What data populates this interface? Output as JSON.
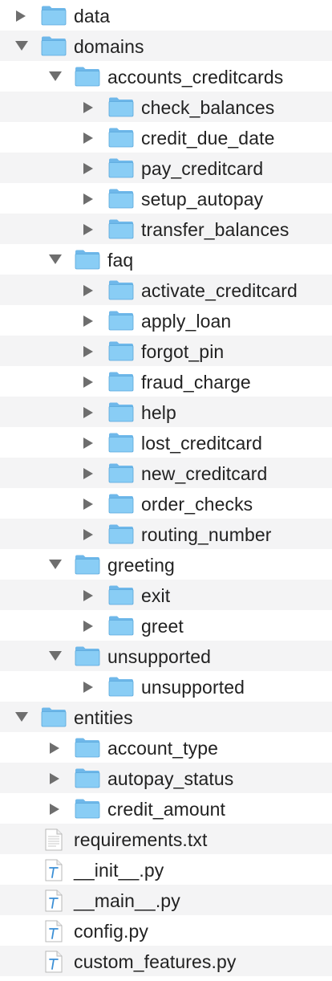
{
  "colors": {
    "folder_body": "#89cdf5",
    "folder_tab": "#6fb8ea",
    "folder_outline": "#5aa7db",
    "disclosure_arrow": "#6e6e6e",
    "row_stripe": "#f4f4f5",
    "text": "#222222"
  },
  "items": [
    {
      "label": "data",
      "type": "folder",
      "depth": 0,
      "expanded": false
    },
    {
      "label": "domains",
      "type": "folder",
      "depth": 0,
      "expanded": true
    },
    {
      "label": "accounts_creditcards",
      "type": "folder",
      "depth": 1,
      "expanded": true
    },
    {
      "label": "check_balances",
      "type": "folder",
      "depth": 2,
      "expanded": false
    },
    {
      "label": "credit_due_date",
      "type": "folder",
      "depth": 2,
      "expanded": false
    },
    {
      "label": "pay_creditcard",
      "type": "folder",
      "depth": 2,
      "expanded": false
    },
    {
      "label": "setup_autopay",
      "type": "folder",
      "depth": 2,
      "expanded": false
    },
    {
      "label": "transfer_balances",
      "type": "folder",
      "depth": 2,
      "expanded": false
    },
    {
      "label": "faq",
      "type": "folder",
      "depth": 1,
      "expanded": true
    },
    {
      "label": "activate_creditcard",
      "type": "folder",
      "depth": 2,
      "expanded": false
    },
    {
      "label": "apply_loan",
      "type": "folder",
      "depth": 2,
      "expanded": false
    },
    {
      "label": "forgot_pin",
      "type": "folder",
      "depth": 2,
      "expanded": false
    },
    {
      "label": "fraud_charge",
      "type": "folder",
      "depth": 2,
      "expanded": false
    },
    {
      "label": "help",
      "type": "folder",
      "depth": 2,
      "expanded": false
    },
    {
      "label": "lost_creditcard",
      "type": "folder",
      "depth": 2,
      "expanded": false
    },
    {
      "label": "new_creditcard",
      "type": "folder",
      "depth": 2,
      "expanded": false
    },
    {
      "label": "order_checks",
      "type": "folder",
      "depth": 2,
      "expanded": false
    },
    {
      "label": "routing_number",
      "type": "folder",
      "depth": 2,
      "expanded": false
    },
    {
      "label": "greeting",
      "type": "folder",
      "depth": 1,
      "expanded": true
    },
    {
      "label": "exit",
      "type": "folder",
      "depth": 2,
      "expanded": false
    },
    {
      "label": "greet",
      "type": "folder",
      "depth": 2,
      "expanded": false
    },
    {
      "label": "unsupported",
      "type": "folder",
      "depth": 1,
      "expanded": true
    },
    {
      "label": "unsupported",
      "type": "folder",
      "depth": 2,
      "expanded": false
    },
    {
      "label": "entities",
      "type": "folder",
      "depth": 0,
      "expanded": true
    },
    {
      "label": "account_type",
      "type": "folder",
      "depth": 1,
      "expanded": false
    },
    {
      "label": "autopay_status",
      "type": "folder",
      "depth": 1,
      "expanded": false
    },
    {
      "label": "credit_amount",
      "type": "folder",
      "depth": 1,
      "expanded": false
    },
    {
      "label": "requirements.txt",
      "type": "text-file",
      "depth": 0
    },
    {
      "label": "__init__.py",
      "type": "python-file",
      "depth": 0
    },
    {
      "label": "__main__.py",
      "type": "python-file",
      "depth": 0
    },
    {
      "label": "config.py",
      "type": "python-file",
      "depth": 0
    },
    {
      "label": "custom_features.py",
      "type": "python-file",
      "depth": 0
    }
  ]
}
